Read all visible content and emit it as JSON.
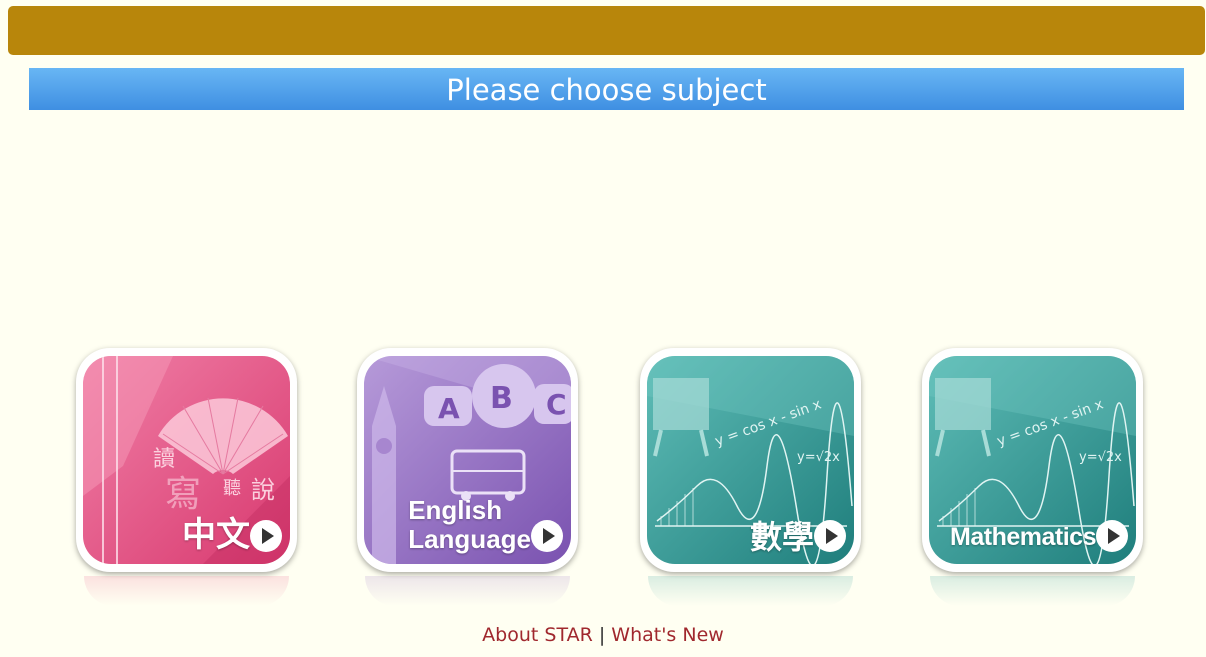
{
  "header": {
    "title": "Please choose subject"
  },
  "subjects": [
    {
      "label": "中文",
      "icon": "chinese-fan-icon",
      "color": "#e85c8a"
    },
    {
      "label_line1": "English",
      "label_line2": "Language",
      "icon": "abc-speech-bubble-icon",
      "color": "#9a74c4"
    },
    {
      "label": "數學",
      "icon": "math-board-icon",
      "color": "#2e9a96"
    },
    {
      "label": "Mathematics",
      "icon": "math-board-icon",
      "color": "#2e9a96"
    }
  ],
  "footer": {
    "about": "About STAR",
    "separator": "|",
    "whats_new": "What's New"
  },
  "colors": {
    "top_bar": "#b8860b",
    "header_bg": "#4f9fe9",
    "page_bg": "#fffff2",
    "footer_link": "#a0282e"
  }
}
